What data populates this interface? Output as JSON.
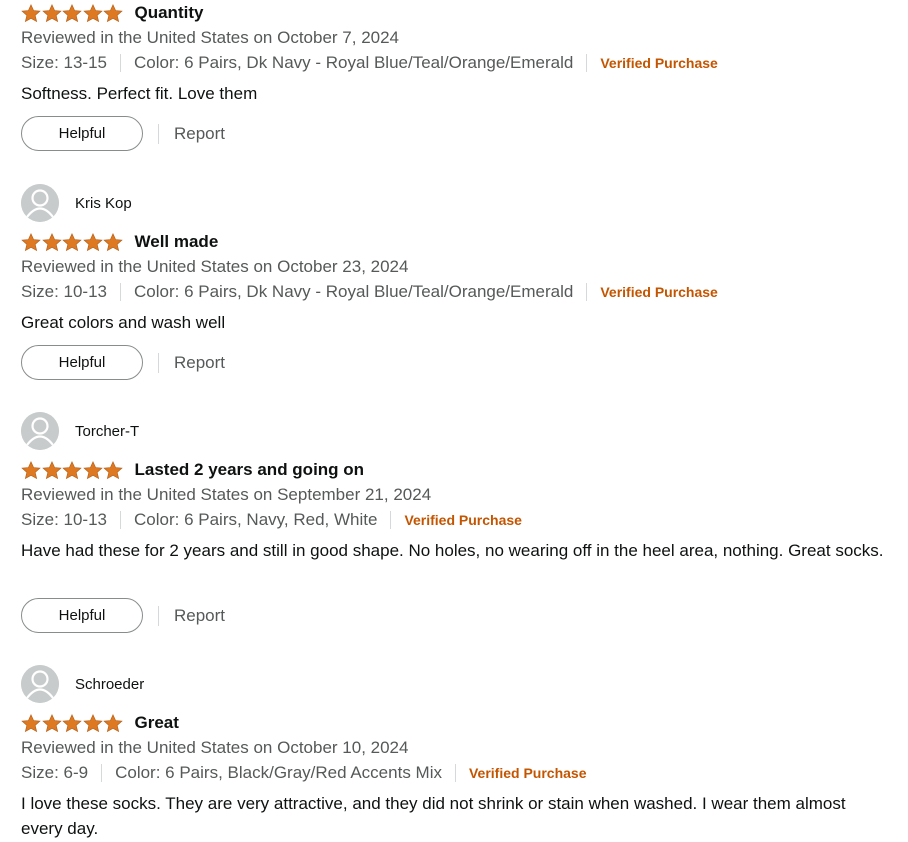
{
  "colors": {
    "star": "#de7921",
    "verified": "#c45500",
    "muted": "#565959"
  },
  "reviews": [
    {
      "author": "",
      "rating": 5,
      "title": "Quantity",
      "date": "Reviewed in the United States on October 7, 2024",
      "size": "Size: 13-15",
      "color": "Color: 6 Pairs, Dk Navy - Royal Blue/Teal/Orange/Emerald",
      "verified": "Verified Purchase",
      "body": "Softness. Perfect fit. Love them",
      "helpful_label": "Helpful",
      "report_label": "Report"
    },
    {
      "author": "Kris Kop",
      "rating": 5,
      "title": "Well made",
      "date": "Reviewed in the United States on October 23, 2024",
      "size": "Size: 10-13",
      "color": "Color: 6 Pairs, Dk Navy - Royal Blue/Teal/Orange/Emerald",
      "verified": "Verified Purchase",
      "body": "Great colors and wash well",
      "helpful_label": "Helpful",
      "report_label": "Report"
    },
    {
      "author": "Torcher-T",
      "rating": 5,
      "title": "Lasted 2 years and going on",
      "date": "Reviewed in the United States on September 21, 2024",
      "size": "Size: 10-13",
      "color": "Color: 6 Pairs, Navy, Red, White",
      "verified": "Verified Purchase",
      "body": "Have had these for 2 years and still in good shape. No holes, no wearing off in the heel area, nothing. Great socks.",
      "helpful_label": "Helpful",
      "report_label": "Report"
    },
    {
      "author": "Schroeder",
      "rating": 5,
      "title": "Great",
      "date": "Reviewed in the United States on October 10, 2024",
      "size": "Size: 6-9",
      "color": "Color: 6 Pairs, Black/Gray/Red Accents Mix",
      "verified": "Verified Purchase",
      "body": "I love these socks. They are very attractive, and they did not shrink or stain when washed. I wear them almost every day."
    }
  ]
}
